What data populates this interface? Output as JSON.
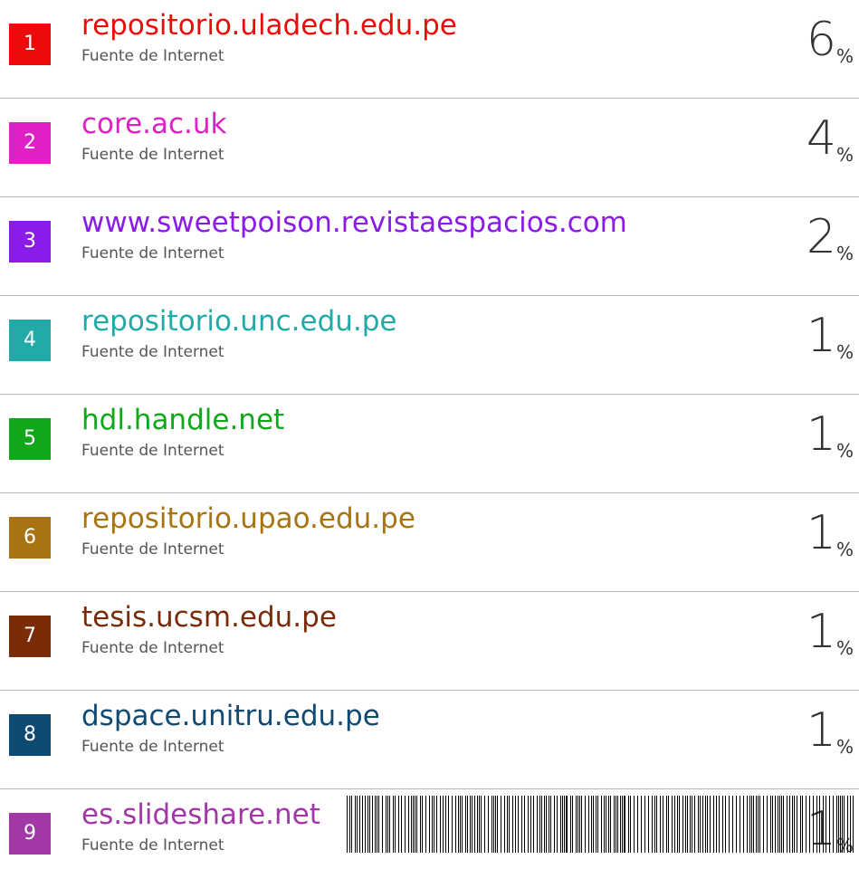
{
  "sources": [
    {
      "rank": "1",
      "name": "repositorio.uladech.edu.pe",
      "type": "Fuente de Internet",
      "percent": "6",
      "unit": "%",
      "color": "#ec0b0b"
    },
    {
      "rank": "2",
      "name": "core.ac.uk",
      "type": "Fuente de Internet",
      "percent": "4",
      "unit": "%",
      "color": "#e01fc6"
    },
    {
      "rank": "3",
      "name": "www.sweetpoison.revistaespacios.com",
      "type": "Fuente de Internet",
      "percent": "2",
      "unit": "%",
      "color": "#8a1be8"
    },
    {
      "rank": "4",
      "name": "repositorio.unc.edu.pe",
      "type": "Fuente de Internet",
      "percent": "1",
      "unit": "%",
      "color": "#20aaa8"
    },
    {
      "rank": "5",
      "name": "hdl.handle.net",
      "type": "Fuente de Internet",
      "percent": "1",
      "unit": "%",
      "color": "#10a81a"
    },
    {
      "rank": "6",
      "name": "repositorio.upao.edu.pe",
      "type": "Fuente de Internet",
      "percent": "1",
      "unit": "%",
      "color": "#a87310"
    },
    {
      "rank": "7",
      "name": "tesis.ucsm.edu.pe",
      "type": "Fuente de Internet",
      "percent": "1",
      "unit": "%",
      "color": "#7a2c08"
    },
    {
      "rank": "8",
      "name": "dspace.unitru.edu.pe",
      "type": "Fuente de Internet",
      "percent": "1",
      "unit": "%",
      "color": "#0f4a72"
    },
    {
      "rank": "9",
      "name": "es.slideshare.net",
      "type": "Fuente de Internet",
      "percent": "1",
      "unit": "%",
      "color": "#a237a8"
    }
  ]
}
